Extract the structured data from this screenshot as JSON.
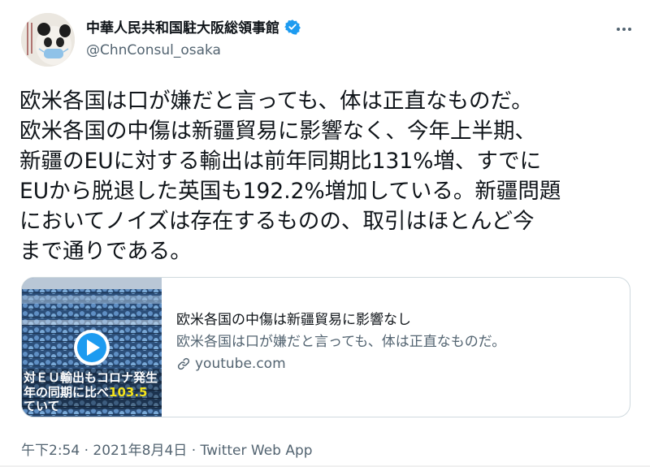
{
  "account": {
    "display_name": "中華人民共和国駐大阪総領事館",
    "handle": "@ChnConsul_osaka"
  },
  "tweet": {
    "text": "欧米各国は口が嫌だと言っても、体は正直なものだ。\n欧米各国の中傷は新疆貿易に影響なく、今年上半期、\n新疆のEUに対する輸出は前年同期比131%増、すでに\nEUから脱退した英国も192.2%増加している。新疆問題\nにおいてノイズは存在するものの、取引はほとんど今\nまで通りである。"
  },
  "link_card": {
    "title": "欧米各国の中傷は新疆貿易に影響なし",
    "description": "欧米各国は口が嫌だと言っても、体は正直なものだ。",
    "domain": "youtube.com",
    "thumbnail_caption_line1": "対ＥＵ輸出もコロナ発生",
    "thumbnail_caption_line2_prefix": "年の同期に比べ",
    "thumbnail_caption_highlight": "103.5",
    "thumbnail_caption_line3": "ていて"
  },
  "footer": {
    "time": "午下2:54",
    "separator": "·",
    "date": "2021年8月4日",
    "source": "Twitter Web App"
  },
  "colors": {
    "verified": "#1d9bf0",
    "secondary_text": "#536471",
    "highlight": "#f2e21b",
    "play_button": "#1d9bf0"
  },
  "icons": [
    "verified-badge-icon",
    "more-options-icon",
    "play-icon",
    "link-icon"
  ]
}
